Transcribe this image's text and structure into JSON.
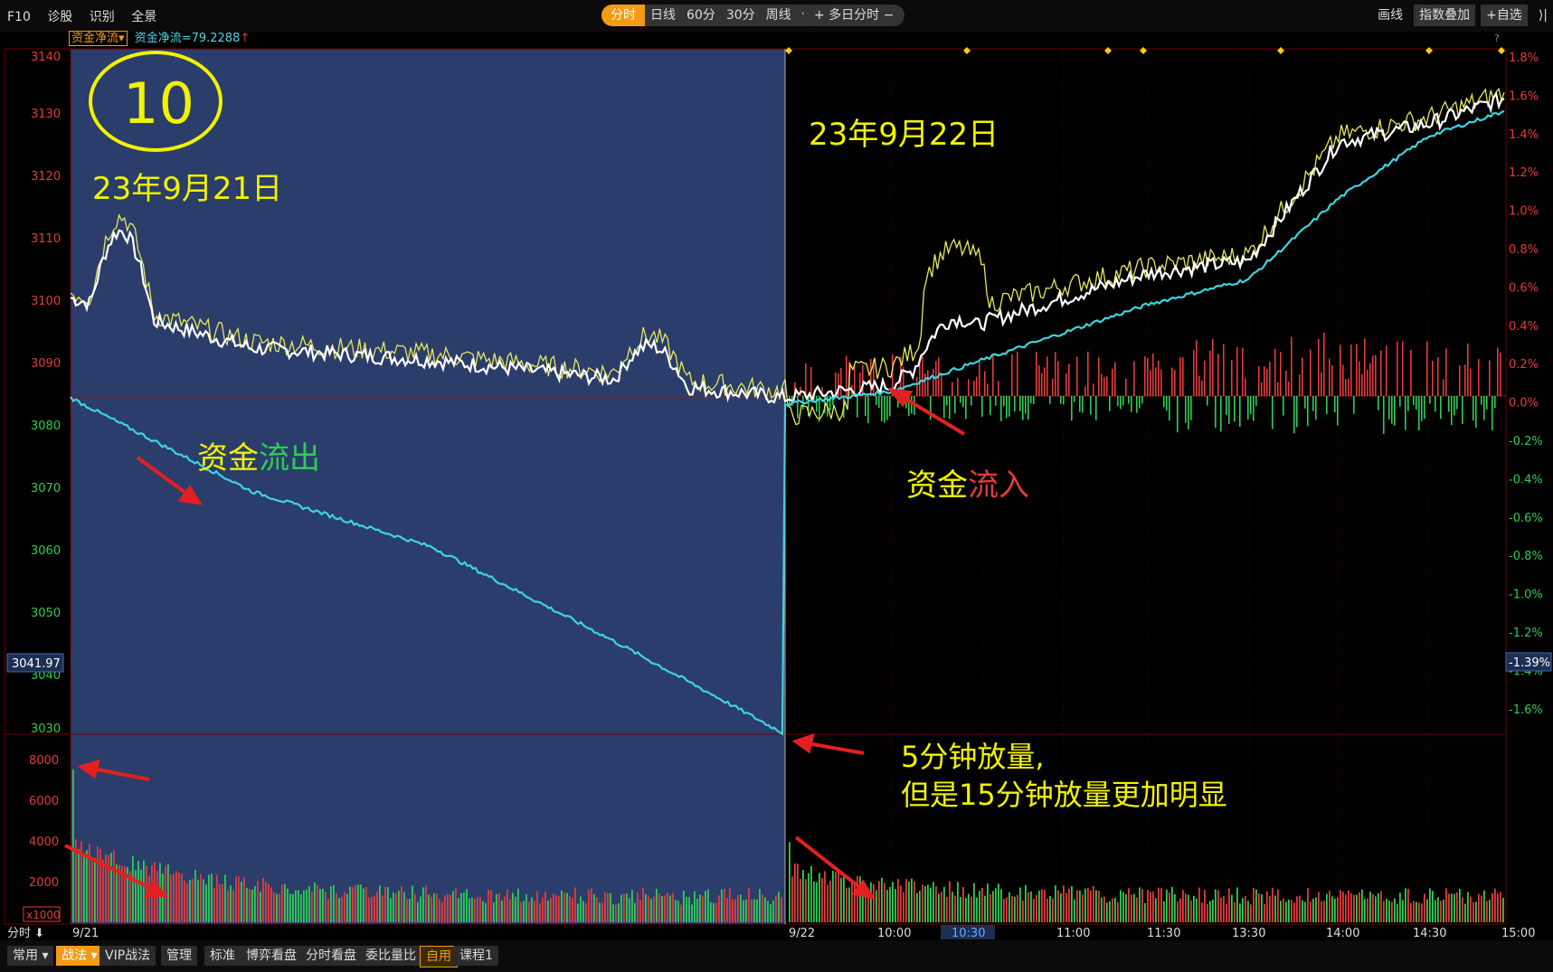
{
  "toolbar": {
    "left_items": [
      "F10",
      "诊股",
      "识别",
      "全景"
    ],
    "periods": [
      "分时",
      "日线",
      "60分",
      "30分",
      "周线"
    ],
    "multi_day": "多日分时",
    "right_items": [
      "画线",
      "指数叠加",
      "自选"
    ]
  },
  "indicator": {
    "name": "资金净流",
    "value": "资金净流=79.2288",
    "arrow": "↑"
  },
  "axes": {
    "left_ticks": [
      "3140",
      "3130",
      "3120",
      "3110",
      "3100",
      "3090",
      "3080",
      "3070",
      "3060",
      "3050",
      "3040",
      "3030"
    ],
    "right_ticks": [
      "1.8%",
      "1.6%",
      "1.4%",
      "1.2%",
      "1.0%",
      "0.8%",
      "0.6%",
      "0.4%",
      "0.2%",
      "0.0%",
      "-0.2%",
      "-0.4%",
      "-0.6%",
      "-0.8%",
      "-1.0%",
      "-1.2%",
      "-1.4%",
      "-1.6%"
    ],
    "price_marker": "3041.97",
    "pct_marker": "-1.39%",
    "vol_ticks": [
      "8000",
      "6000",
      "4000",
      "2000"
    ],
    "vol_unit": "x1000",
    "time_ticks": [
      "9/21",
      "9/22",
      "10:00",
      "10:30",
      "11:00",
      "11:30",
      "13:30",
      "14:00",
      "14:30",
      "15:00"
    ],
    "time_left_label": "分时",
    "help": "?"
  },
  "annotations": {
    "circle_number": "10",
    "date1": "23年9月21日",
    "date2": "23年9月22日",
    "outflow_a": "资金",
    "outflow_b": "流出",
    "inflow_a": "资金",
    "inflow_b": "流入",
    "vol_note_1": "5分钟放量,",
    "vol_note_2": "但是15分钟放量更加明显"
  },
  "bottom_tabs": [
    "常用",
    "战法",
    "VIP战法",
    "管理",
    "标准",
    "博弈看盘",
    "分时看盘",
    "委比量比",
    "自用",
    "课程1"
  ],
  "colors": {
    "up": "#e33b3b",
    "down": "#2ecc55",
    "price": "#ffffff",
    "avg": "#e8e85a",
    "flow": "#3fd3e0",
    "day1_bg": "#2a3d6b",
    "grid": "#6b0000"
  },
  "chart_data": {
    "type": "line",
    "x": [
      "9/21 09:30",
      "9/21 10:30",
      "9/21 11:30",
      "9/21 14:00",
      "9/21 15:00",
      "9/22 09:30",
      "9/22 10:00",
      "9/22 10:30",
      "9/22 11:30",
      "9/22 13:30",
      "9/22 14:00",
      "9/22 14:30",
      "9/22 15:00"
    ],
    "series": [
      {
        "name": "",
        "values": [
          3100,
          3092,
          3090,
          3087,
          3084,
          3084,
          3086,
          3096,
          3104,
          3106,
          3125,
          3128,
          3132
        ]
      },
      {
        "name": "资金净流",
        "values": [
          3084,
          3069,
          3060,
          3045,
          3030,
          3083,
          3085,
          3090,
          3099,
          3103,
          3116,
          3126,
          3130
        ]
      }
    ],
    "ylim": [
      3030,
      3140
    ],
    "volume_unit": "x1000",
    "volume_peaks": [
      8000,
      4200
    ]
  }
}
